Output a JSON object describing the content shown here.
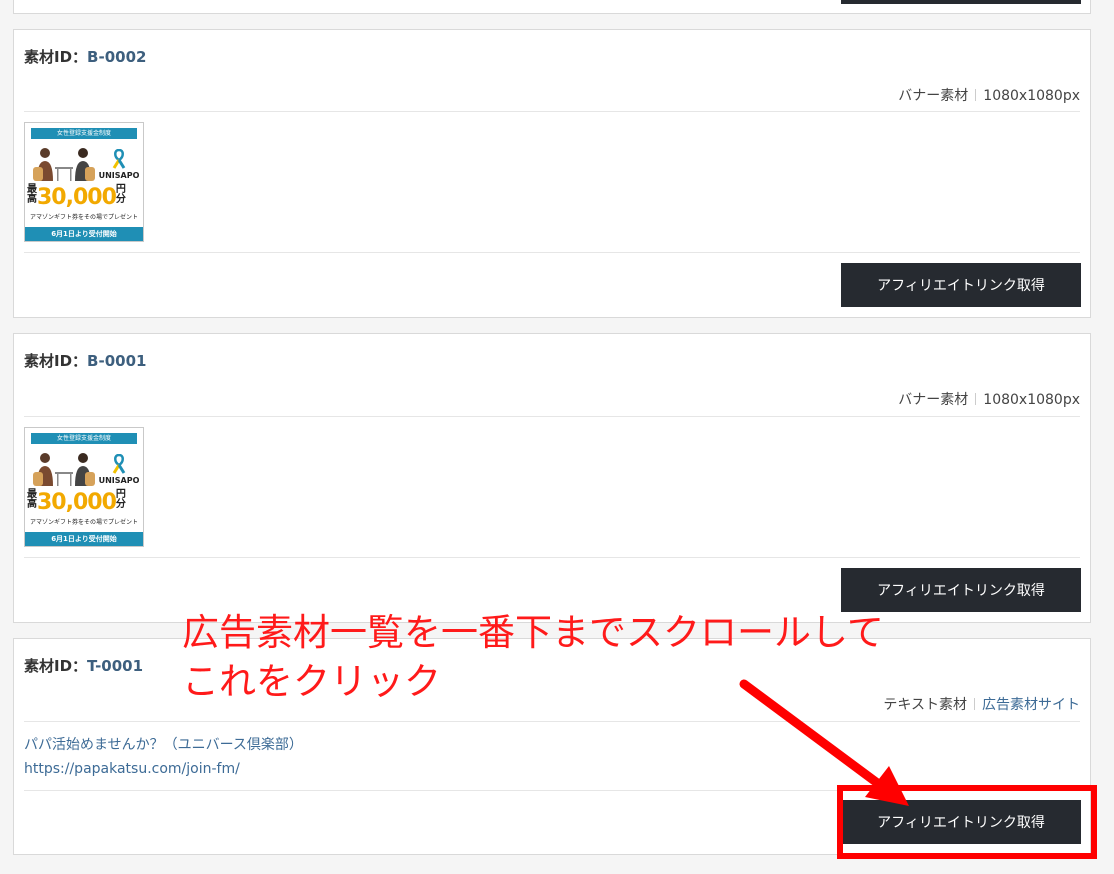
{
  "cards": [
    {
      "id_label": "素材ID：",
      "id_value": "B-0002",
      "type": "バナー素材",
      "size": "1080x1080px",
      "button_label": "アフィリエイトリンク取得",
      "banner": {
        "header": "女性登録支援金制度",
        "brand": "UNISAPO",
        "prefix": "最高",
        "amount": "30,000",
        "suffix": "円分",
        "sub": "アマゾンギフト券をその場でプレゼント",
        "footer": "6月1日より受付開始"
      }
    },
    {
      "id_label": "素材ID：",
      "id_value": "B-0001",
      "type": "バナー素材",
      "size": "1080x1080px",
      "button_label": "アフィリエイトリンク取得",
      "banner": {
        "header": "女性登録支援金制度",
        "brand": "UNISAPO",
        "prefix": "最高",
        "amount": "30,000",
        "suffix": "円分",
        "sub": "アマゾンギフト券をその場でプレゼント",
        "footer": "6月1日より受付開始"
      }
    },
    {
      "id_label": "素材ID：",
      "id_value": "T-0001",
      "type": "テキスト素材",
      "site_link": "広告素材サイト",
      "text_title": "パパ活始めませんか？（ユニバース倶楽部）",
      "text_url": "https://papakatsu.com/join-fm/",
      "button_label": "アフィリエイトリンク取得"
    }
  ],
  "top_partial_button": "",
  "annotation": {
    "line1": "広告素材一覧を一番下までスクロールして",
    "line2": "これをクリック",
    "color": "#ff0000"
  },
  "colors": {
    "button_bg": "#262a30",
    "id_value": "#3d5f7e",
    "link": "#3d6b96"
  }
}
